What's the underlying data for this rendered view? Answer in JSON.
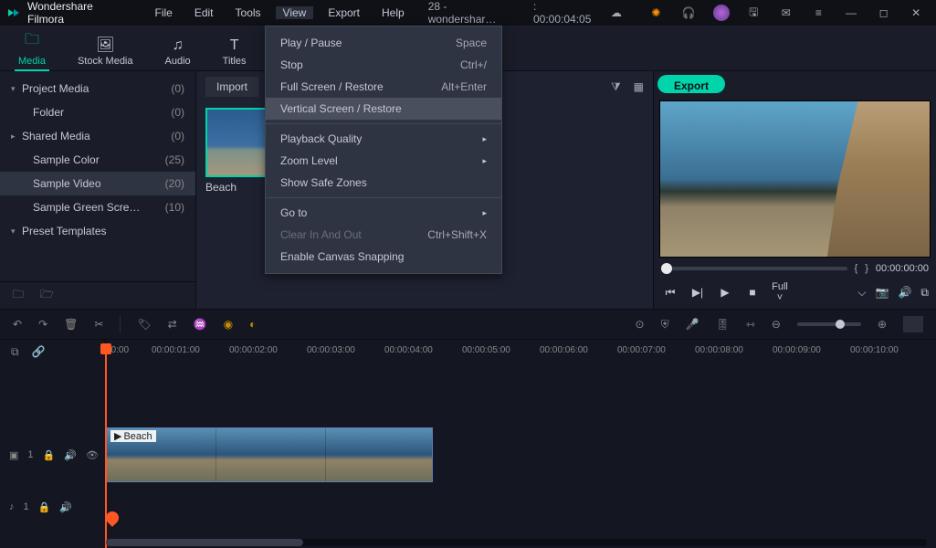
{
  "app": {
    "title": "Wondershare Filmora"
  },
  "menubar": {
    "file": "File",
    "edit": "Edit",
    "tools": "Tools",
    "view": "View",
    "export": "Export",
    "help": "Help"
  },
  "project": {
    "name": "28 - wondershar…",
    "timecode": ": 00:00:04:05"
  },
  "tabs": {
    "media": "Media",
    "stock": "Stock Media",
    "audio": "Audio",
    "titles": "Titles"
  },
  "sidebar": {
    "items": [
      {
        "label": "Project Media",
        "count": "(0)",
        "arrow": "▾"
      },
      {
        "label": "Folder",
        "count": "(0)",
        "arrow": "",
        "indent": true
      },
      {
        "label": "Shared Media",
        "count": "(0)",
        "arrow": "▸"
      },
      {
        "label": "Sample Color",
        "count": "(25)",
        "arrow": "",
        "indent": true
      },
      {
        "label": "Sample Video",
        "count": "(20)",
        "arrow": "",
        "indent": true,
        "selected": true
      },
      {
        "label": "Sample Green Scre…",
        "count": "(10)",
        "arrow": "",
        "indent": true
      },
      {
        "label": "Preset Templates",
        "count": "",
        "arrow": "▾"
      }
    ]
  },
  "media": {
    "import": "Import",
    "items": [
      {
        "label": "Beach"
      }
    ]
  },
  "dropdown": {
    "play_pause": "Play / Pause",
    "play_pause_sc": "Space",
    "stop": "Stop",
    "stop_sc": "Ctrl+/",
    "fullscreen": "Full Screen / Restore",
    "fullscreen_sc": "Alt+Enter",
    "vertical": "Vertical Screen / Restore",
    "playback_quality": "Playback Quality",
    "zoom_level": "Zoom Level",
    "safe_zones": "Show Safe Zones",
    "goto": "Go to",
    "clear_io": "Clear In And Out",
    "clear_io_sc": "Ctrl+Shift+X",
    "canvas_snap": "Enable Canvas Snapping"
  },
  "export_btn": "Export",
  "preview": {
    "markers_left": "{",
    "markers_right": "}",
    "timecode": "00:00:00:00",
    "full": "Full ˅"
  },
  "timeline": {
    "ticks": [
      "00:00",
      "00:00:01:00",
      "00:00:02:00",
      "00:00:03:00",
      "00:00:04:00",
      "00:00:05:00",
      "00:00:06:00",
      "00:00:07:00",
      "00:00:08:00",
      "00:00:09:00",
      "00:00:10:00"
    ],
    "video_track": "1",
    "audio_track": "1",
    "clip_label": "Beach",
    "track_note": "♪"
  }
}
